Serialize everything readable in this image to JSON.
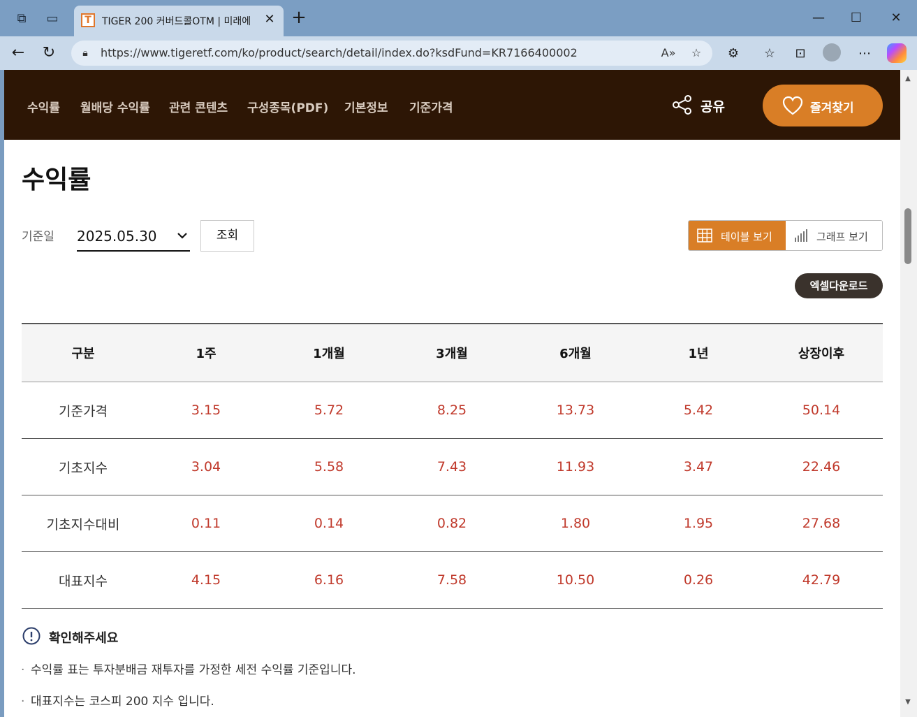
{
  "browser": {
    "tab_title": "TIGER 200 커버드콜OTM | 미래에",
    "tab_favicon": "T",
    "url": "https://www.tigeretf.com/ko/product/search/detail/index.do?ksdFund=KR7166400002"
  },
  "nav": {
    "links": [
      "수익률",
      "월배당 수익률",
      "관련 콘텐츠",
      "구성종목(PDF)",
      "기본정보",
      "기준가격"
    ],
    "share_label": "공유",
    "favorite_label": "즐겨찾기",
    "colors": {
      "nav_bg": "#2d1605",
      "accent": "#d97e26"
    }
  },
  "section": {
    "title": "수익률",
    "date_label": "기준일",
    "date_value": "2025.05.30",
    "query_button": "조회",
    "view_table_label": "테이블 보기",
    "view_graph_label": "그래프 보기",
    "excel_label": "엑셀다운로드"
  },
  "table": {
    "headers": [
      "구분",
      "1주",
      "1개월",
      "3개월",
      "6개월",
      "1년",
      "상장이후"
    ],
    "rows": [
      {
        "label": "기준가격",
        "values": [
          "3.15",
          "5.72",
          "8.25",
          "13.73",
          "5.42",
          "50.14"
        ]
      },
      {
        "label": "기초지수",
        "values": [
          "3.04",
          "5.58",
          "7.43",
          "11.93",
          "3.47",
          "22.46"
        ]
      },
      {
        "label": "기초지수대비",
        "values": [
          "0.11",
          "0.14",
          "0.82",
          "1.80",
          "1.95",
          "27.68"
        ]
      },
      {
        "label": "대표지수",
        "values": [
          "4.15",
          "6.16",
          "7.58",
          "10.50",
          "0.26",
          "42.79"
        ]
      }
    ],
    "value_color": "#c0392b"
  },
  "notice": {
    "title": "확인해주세요",
    "items": [
      "수익률 표는 투자분배금 재투자를 가정한 세전 수익률 기준입니다.",
      "대표지수는 코스피 200 지수 입니다."
    ]
  }
}
